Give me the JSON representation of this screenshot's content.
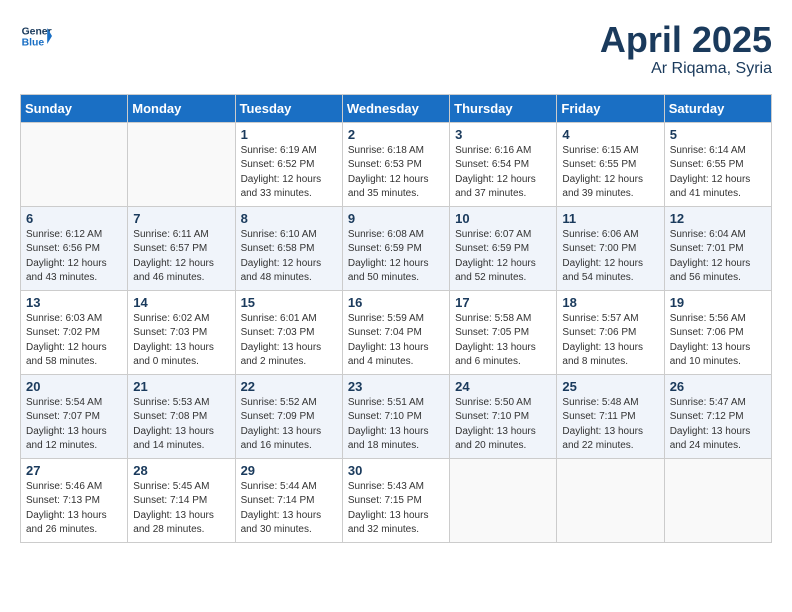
{
  "header": {
    "logo_line1": "General",
    "logo_line2": "Blue",
    "month": "April 2025",
    "location": "Ar Riqama, Syria"
  },
  "days_of_week": [
    "Sunday",
    "Monday",
    "Tuesday",
    "Wednesday",
    "Thursday",
    "Friday",
    "Saturday"
  ],
  "weeks": [
    [
      {
        "day": "",
        "info": ""
      },
      {
        "day": "",
        "info": ""
      },
      {
        "day": "1",
        "info": "Sunrise: 6:19 AM\nSunset: 6:52 PM\nDaylight: 12 hours\nand 33 minutes."
      },
      {
        "day": "2",
        "info": "Sunrise: 6:18 AM\nSunset: 6:53 PM\nDaylight: 12 hours\nand 35 minutes."
      },
      {
        "day": "3",
        "info": "Sunrise: 6:16 AM\nSunset: 6:54 PM\nDaylight: 12 hours\nand 37 minutes."
      },
      {
        "day": "4",
        "info": "Sunrise: 6:15 AM\nSunset: 6:55 PM\nDaylight: 12 hours\nand 39 minutes."
      },
      {
        "day": "5",
        "info": "Sunrise: 6:14 AM\nSunset: 6:55 PM\nDaylight: 12 hours\nand 41 minutes."
      }
    ],
    [
      {
        "day": "6",
        "info": "Sunrise: 6:12 AM\nSunset: 6:56 PM\nDaylight: 12 hours\nand 43 minutes."
      },
      {
        "day": "7",
        "info": "Sunrise: 6:11 AM\nSunset: 6:57 PM\nDaylight: 12 hours\nand 46 minutes."
      },
      {
        "day": "8",
        "info": "Sunrise: 6:10 AM\nSunset: 6:58 PM\nDaylight: 12 hours\nand 48 minutes."
      },
      {
        "day": "9",
        "info": "Sunrise: 6:08 AM\nSunset: 6:59 PM\nDaylight: 12 hours\nand 50 minutes."
      },
      {
        "day": "10",
        "info": "Sunrise: 6:07 AM\nSunset: 6:59 PM\nDaylight: 12 hours\nand 52 minutes."
      },
      {
        "day": "11",
        "info": "Sunrise: 6:06 AM\nSunset: 7:00 PM\nDaylight: 12 hours\nand 54 minutes."
      },
      {
        "day": "12",
        "info": "Sunrise: 6:04 AM\nSunset: 7:01 PM\nDaylight: 12 hours\nand 56 minutes."
      }
    ],
    [
      {
        "day": "13",
        "info": "Sunrise: 6:03 AM\nSunset: 7:02 PM\nDaylight: 12 hours\nand 58 minutes."
      },
      {
        "day": "14",
        "info": "Sunrise: 6:02 AM\nSunset: 7:03 PM\nDaylight: 13 hours\nand 0 minutes."
      },
      {
        "day": "15",
        "info": "Sunrise: 6:01 AM\nSunset: 7:03 PM\nDaylight: 13 hours\nand 2 minutes."
      },
      {
        "day": "16",
        "info": "Sunrise: 5:59 AM\nSunset: 7:04 PM\nDaylight: 13 hours\nand 4 minutes."
      },
      {
        "day": "17",
        "info": "Sunrise: 5:58 AM\nSunset: 7:05 PM\nDaylight: 13 hours\nand 6 minutes."
      },
      {
        "day": "18",
        "info": "Sunrise: 5:57 AM\nSunset: 7:06 PM\nDaylight: 13 hours\nand 8 minutes."
      },
      {
        "day": "19",
        "info": "Sunrise: 5:56 AM\nSunset: 7:06 PM\nDaylight: 13 hours\nand 10 minutes."
      }
    ],
    [
      {
        "day": "20",
        "info": "Sunrise: 5:54 AM\nSunset: 7:07 PM\nDaylight: 13 hours\nand 12 minutes."
      },
      {
        "day": "21",
        "info": "Sunrise: 5:53 AM\nSunset: 7:08 PM\nDaylight: 13 hours\nand 14 minutes."
      },
      {
        "day": "22",
        "info": "Sunrise: 5:52 AM\nSunset: 7:09 PM\nDaylight: 13 hours\nand 16 minutes."
      },
      {
        "day": "23",
        "info": "Sunrise: 5:51 AM\nSunset: 7:10 PM\nDaylight: 13 hours\nand 18 minutes."
      },
      {
        "day": "24",
        "info": "Sunrise: 5:50 AM\nSunset: 7:10 PM\nDaylight: 13 hours\nand 20 minutes."
      },
      {
        "day": "25",
        "info": "Sunrise: 5:48 AM\nSunset: 7:11 PM\nDaylight: 13 hours\nand 22 minutes."
      },
      {
        "day": "26",
        "info": "Sunrise: 5:47 AM\nSunset: 7:12 PM\nDaylight: 13 hours\nand 24 minutes."
      }
    ],
    [
      {
        "day": "27",
        "info": "Sunrise: 5:46 AM\nSunset: 7:13 PM\nDaylight: 13 hours\nand 26 minutes."
      },
      {
        "day": "28",
        "info": "Sunrise: 5:45 AM\nSunset: 7:14 PM\nDaylight: 13 hours\nand 28 minutes."
      },
      {
        "day": "29",
        "info": "Sunrise: 5:44 AM\nSunset: 7:14 PM\nDaylight: 13 hours\nand 30 minutes."
      },
      {
        "day": "30",
        "info": "Sunrise: 5:43 AM\nSunset: 7:15 PM\nDaylight: 13 hours\nand 32 minutes."
      },
      {
        "day": "",
        "info": ""
      },
      {
        "day": "",
        "info": ""
      },
      {
        "day": "",
        "info": ""
      }
    ]
  ]
}
